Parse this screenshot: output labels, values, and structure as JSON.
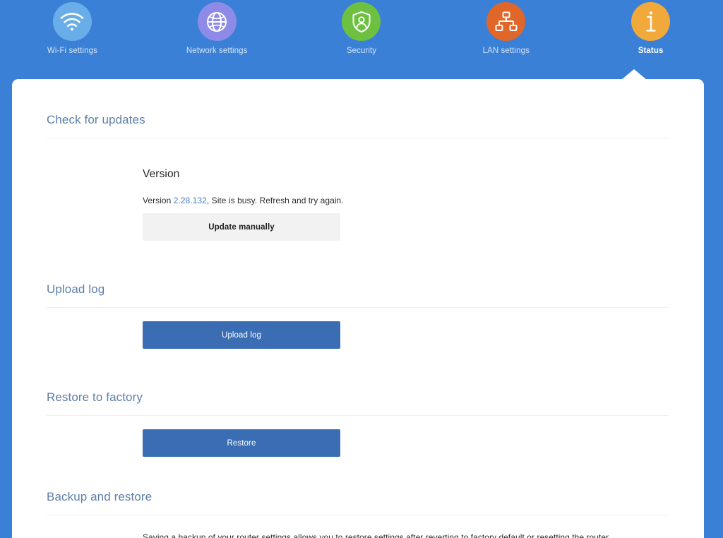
{
  "nav": {
    "items": [
      {
        "label": "Wi-Fi settings",
        "icon": "wifi-icon",
        "color": "#69aee8",
        "active": false
      },
      {
        "label": "Network settings",
        "icon": "globe-icon",
        "color": "#8e8ae8",
        "active": false
      },
      {
        "label": "Security",
        "icon": "shield-person-icon",
        "color": "#6dc040",
        "active": false
      },
      {
        "label": "LAN settings",
        "icon": "sitemap-icon",
        "color": "#e0662a",
        "active": false
      },
      {
        "label": "Status",
        "icon": "info-icon",
        "color": "#f2a93b",
        "active": true
      }
    ]
  },
  "sections": {
    "check_for_updates": {
      "title": "Check for updates",
      "version_heading": "Version",
      "version_prefix": "Version ",
      "version_number": "2.28.132",
      "version_message": ", Site is busy. Refresh and try again.",
      "update_button": "Update manually"
    },
    "upload_log": {
      "title": "Upload log",
      "button": "Upload log"
    },
    "restore_to_factory": {
      "title": "Restore to factory",
      "button": "Restore"
    },
    "backup_and_restore": {
      "title": "Backup and restore",
      "description": "Saving a backup of your router settings allows you to restore settings after reverting to factory default or resetting the router."
    }
  },
  "colors": {
    "header_blue": "#3a80d7",
    "primary_button": "#3a6db3",
    "secondary_button": "#f2f2f3",
    "section_heading": "#5d7fa9",
    "link_blue": "#4a7fc1"
  }
}
